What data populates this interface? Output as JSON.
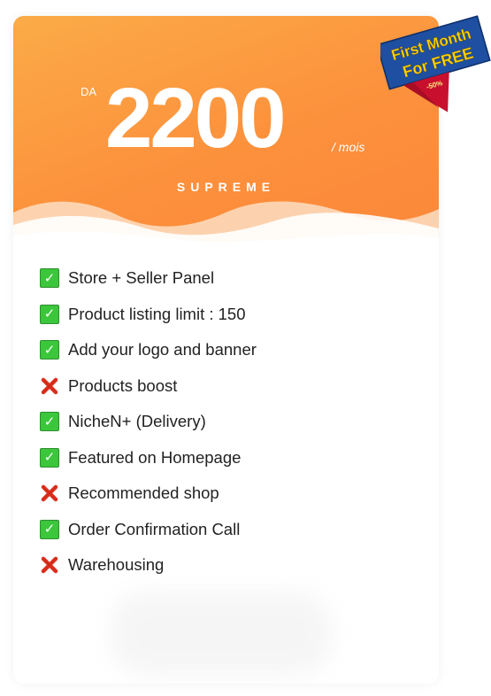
{
  "plan": {
    "currency": "DA",
    "price": "2200",
    "period": "/ mois",
    "name": "SUPREME"
  },
  "badge": {
    "line1": "First Month",
    "line2": "For FREE",
    "discount": "-50%"
  },
  "features": [
    {
      "label": "Store + Seller Panel",
      "included": true,
      "icon": "check-icon"
    },
    {
      "label": "Product listing limit : 150",
      "included": true,
      "icon": "check-icon"
    },
    {
      "label": "Add your logo and banner",
      "included": true,
      "icon": "check-icon"
    },
    {
      "label": "Products boost",
      "included": false,
      "icon": "cross-icon"
    },
    {
      "label": "NicheN+ (Delivery)",
      "included": true,
      "icon": "check-icon"
    },
    {
      "label": "Featured on Homepage",
      "included": true,
      "icon": "check-icon"
    },
    {
      "label": "Recommended shop",
      "included": false,
      "icon": "cross-icon"
    },
    {
      "label": "Order Confirmation Call",
      "included": true,
      "icon": "check-icon"
    },
    {
      "label": "Warehousing",
      "included": false,
      "icon": "cross-icon"
    }
  ],
  "colors": {
    "header_start": "#fbab48",
    "header_end": "#fb873a",
    "check": "#3cc63c",
    "cross": "#e0301e",
    "ribbon_blue": "#1f4fa0",
    "ribbon_red": "#c8102e",
    "ribbon_text": "#ffd400"
  }
}
